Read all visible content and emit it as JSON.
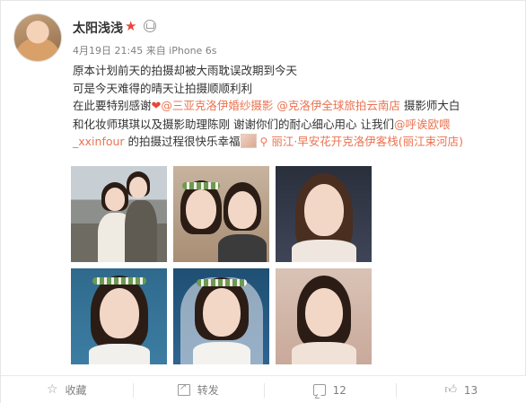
{
  "post": {
    "author": "太阳浅浅",
    "meta": "4月19日 21:45 来自 iPhone 6s",
    "lines": [
      [
        "原本计划前天的拍摄却被大雨耽误改期到今天"
      ],
      [
        "可是今天难得的晴天让拍摄顺顺利利"
      ],
      [
        "在此要特别感谢",
        "@三亚克洛伊婚纱摄影",
        "@克洛伊全球旅拍云南店",
        " 摄影师大白"
      ],
      [
        "和化妆师琪琪以及摄影助理陈刚 谢谢你们的耐心细心用心 让我们",
        "@呼诶欧喂"
      ],
      [
        "_xxinfour",
        " 的拍摄过程很快乐幸福",
        "丽江·早安花开克洛伊客栈(丽江束河店)"
      ]
    ]
  },
  "icons": {
    "vip": "star-icon",
    "crown": "crown-icon",
    "heart": "heart-icon",
    "location": "location-icon"
  },
  "photos": [
    "photo-1",
    "photo-2",
    "photo-3",
    "photo-4",
    "photo-5",
    "photo-6"
  ],
  "actions": {
    "favorite": "收藏",
    "repost": "转发",
    "comment_count": "12",
    "like_count": "13"
  },
  "colors": {
    "link": "#eb7350",
    "accent_red": "#e8463a"
  }
}
